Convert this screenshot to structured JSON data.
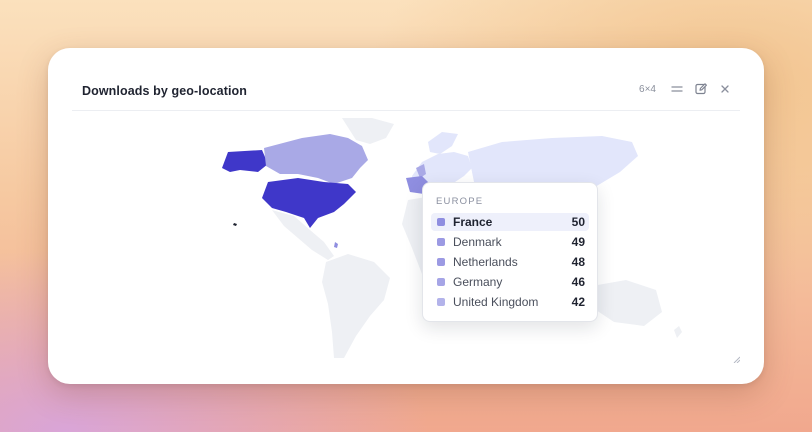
{
  "widget": {
    "title": "Downloads by geo-location",
    "size_badge": "6×4",
    "icons": {
      "menu": "menu-icon",
      "edit": "edit-icon",
      "close": "close-icon"
    }
  },
  "colors": {
    "accent_dark": "#3f37c9",
    "accent_mid": "#8f8ee0",
    "accent_light": "#a9a9e6",
    "land_faint": "#e2e6fb",
    "land_empty": "#eef0f4"
  },
  "tooltip": {
    "region": "EUROPE",
    "rows": [
      {
        "country": "France",
        "value": "50",
        "active": true
      },
      {
        "country": "Denmark",
        "value": "49",
        "active": false
      },
      {
        "country": "Netherlands",
        "value": "48",
        "active": false
      },
      {
        "country": "Germany",
        "value": "46",
        "active": false
      },
      {
        "country": "United Kingdom",
        "value": "42",
        "active": false
      }
    ]
  }
}
